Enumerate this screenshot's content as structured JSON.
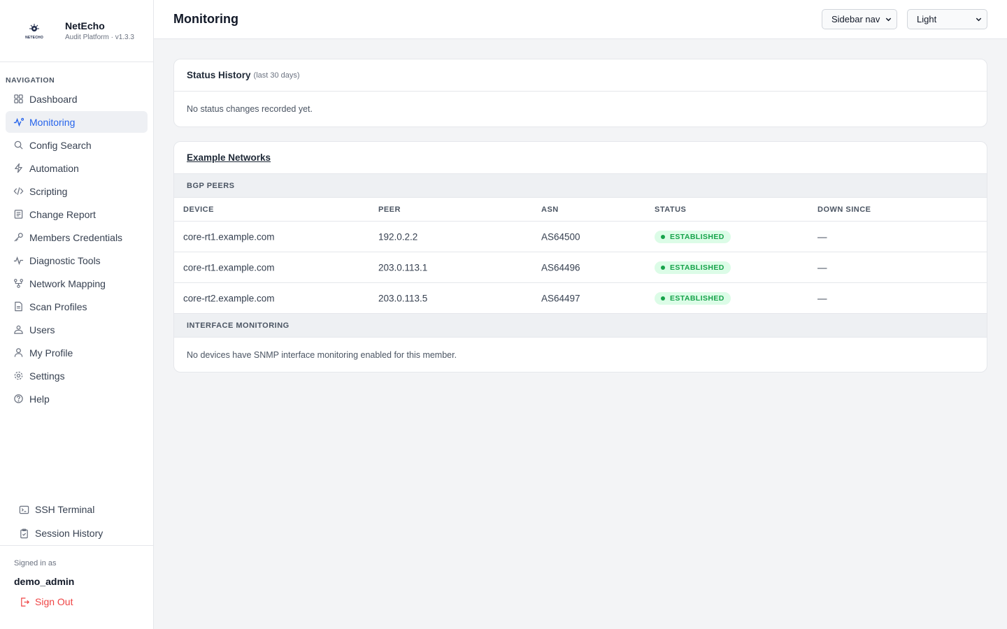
{
  "brand": {
    "logo_text": "NETECHO",
    "name": "NetEcho",
    "subtitle": "Audit Platform · v1.3.3"
  },
  "sidebar": {
    "heading": "NAVIGATION",
    "items": [
      {
        "label": "Dashboard",
        "icon": "grid-icon",
        "active": false
      },
      {
        "label": "Monitoring",
        "icon": "activity-icon",
        "active": true
      },
      {
        "label": "Config Search",
        "icon": "search-icon",
        "active": false
      },
      {
        "label": "Automation",
        "icon": "zap-icon",
        "active": false
      },
      {
        "label": "Scripting",
        "icon": "code-icon",
        "active": false
      },
      {
        "label": "Change Report",
        "icon": "document-icon",
        "active": false
      },
      {
        "label": "Members Credentials",
        "icon": "key-icon",
        "active": false
      },
      {
        "label": "Diagnostic Tools",
        "icon": "pulse-icon",
        "active": false
      },
      {
        "label": "Network Mapping",
        "icon": "network-icon",
        "active": false
      },
      {
        "label": "Scan Profiles",
        "icon": "file-icon",
        "active": false
      },
      {
        "label": "Users",
        "icon": "users-icon",
        "active": false
      },
      {
        "label": "My Profile",
        "icon": "user-icon",
        "active": false
      },
      {
        "label": "Settings",
        "icon": "gear-icon",
        "active": false
      },
      {
        "label": "Help",
        "icon": "help-icon",
        "active": false
      }
    ],
    "tools": [
      {
        "label": "SSH Terminal",
        "icon": "terminal-icon"
      },
      {
        "label": "Session History",
        "icon": "clipboard-icon"
      }
    ],
    "user": {
      "signed_in_label": "Signed in as",
      "username": "demo_admin",
      "sign_out": "Sign Out"
    }
  },
  "header": {
    "title": "Monitoring",
    "nav_select": "Sidebar nav",
    "theme_select": "Light"
  },
  "status_history": {
    "title": "Status History",
    "subtitle": "(last 30 days)",
    "empty_text": "No status changes recorded yet."
  },
  "networks": {
    "title": "Example Networks",
    "bgp_section": "BGP PEERS",
    "columns": [
      "DEVICE",
      "PEER",
      "ASN",
      "STATUS",
      "DOWN SINCE"
    ],
    "rows": [
      {
        "device": "core-rt1.example.com",
        "peer": "192.0.2.2",
        "asn": "AS64500",
        "status": "ESTABLISHED",
        "down_since": "—"
      },
      {
        "device": "core-rt1.example.com",
        "peer": "203.0.113.1",
        "asn": "AS64496",
        "status": "ESTABLISHED",
        "down_since": "—"
      },
      {
        "device": "core-rt2.example.com",
        "peer": "203.0.113.5",
        "asn": "AS64497",
        "status": "ESTABLISHED",
        "down_since": "—"
      }
    ],
    "interface_section": "INTERFACE MONITORING",
    "interface_empty": "No devices have SNMP interface monitoring enabled for this member."
  },
  "colors": {
    "accent": "#2563eb",
    "status_ok": "#16a34a",
    "status_ok_bg": "#dcfce7",
    "danger": "#ef4444"
  }
}
